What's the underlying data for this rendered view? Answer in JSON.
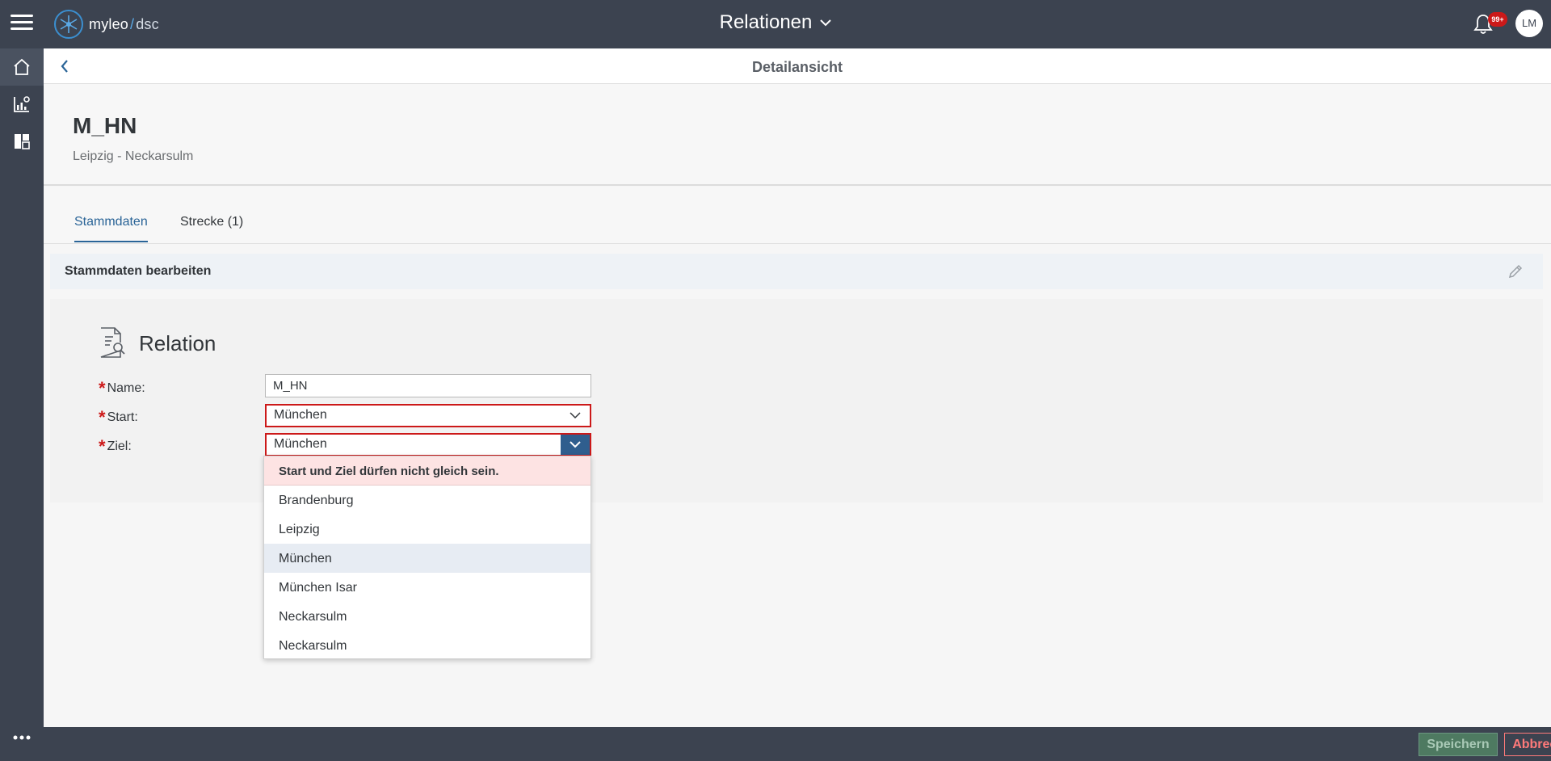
{
  "header": {
    "logo_name": "myleo",
    "logo_slash": "/",
    "logo_product": "dsc",
    "title": "Relationen",
    "notification_badge": "99+",
    "user_initials": "LM"
  },
  "sidenav": {
    "items": [
      {
        "icon": "home-icon",
        "active": true
      },
      {
        "icon": "analytics-icon",
        "active": false
      },
      {
        "icon": "dashboard-icon",
        "active": false
      }
    ],
    "more_icon": "more-icon"
  },
  "subheader": {
    "title": "Detailansicht"
  },
  "object": {
    "title": "M_HN",
    "subtitle": "Leipzig - Neckarsulm"
  },
  "tabs": [
    {
      "label": "Stammdaten",
      "active": true
    },
    {
      "label": "Strecke (1)",
      "active": false
    }
  ],
  "section": {
    "title": "Stammdaten bearbeiten"
  },
  "form": {
    "heading": "Relation",
    "required_marker": "*",
    "fields": {
      "name": {
        "label": "Name:",
        "value": "M_HN"
      },
      "start": {
        "label": "Start:",
        "value": "München"
      },
      "ziel": {
        "label": "Ziel:",
        "value": "München"
      }
    }
  },
  "dropdown": {
    "error": "Start und Ziel dürfen nicht gleich sein.",
    "options": [
      {
        "label": "Brandenburg",
        "selected": false
      },
      {
        "label": "Leipzig",
        "selected": false
      },
      {
        "label": "München",
        "selected": true
      },
      {
        "label": "München Isar",
        "selected": false
      },
      {
        "label": "Neckarsulm",
        "selected": false
      },
      {
        "label": "Neckarsulm",
        "selected": false
      }
    ]
  },
  "footer": {
    "save_label": "Speichern",
    "cancel_label": "Abbrechen"
  },
  "colors": {
    "header_bg": "#3c4350",
    "accent": "#2a6497",
    "error": "#cc1919",
    "save_green": "#4e7a61"
  }
}
